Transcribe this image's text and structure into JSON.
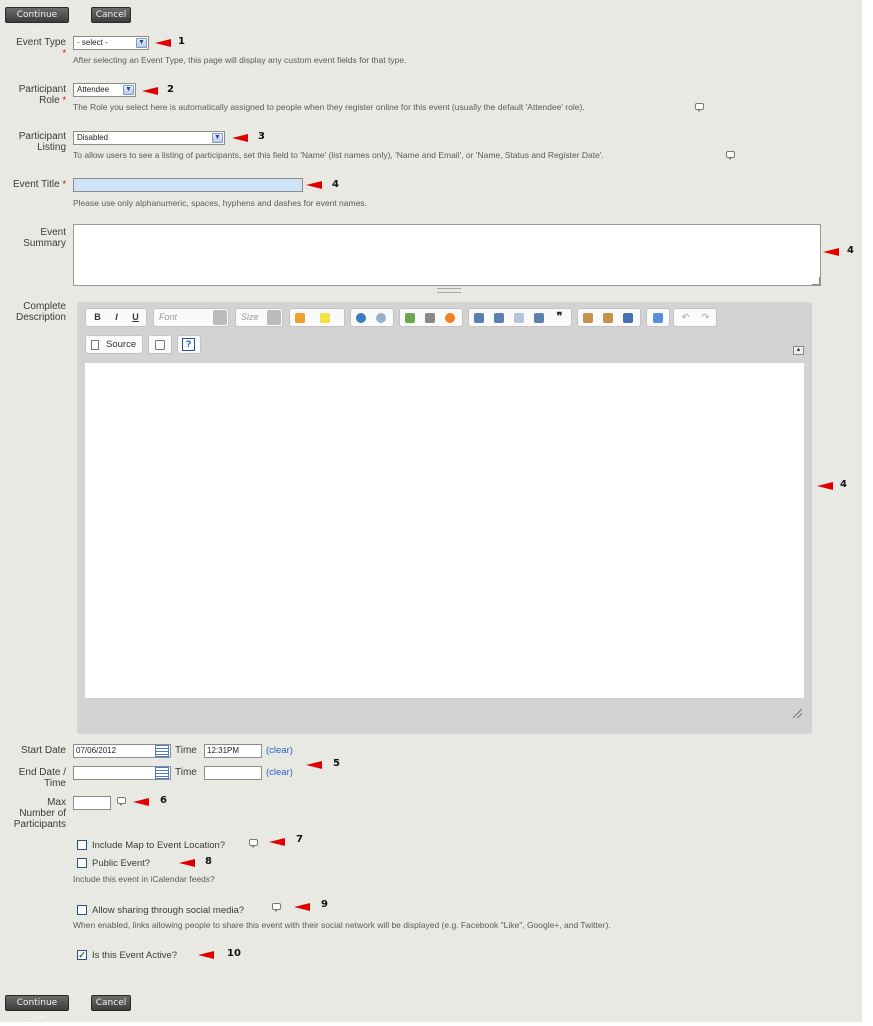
{
  "buttons": {
    "continue": "Continue >>",
    "cancel": "Cancel"
  },
  "fields": {
    "event_type": {
      "label": "Event Type",
      "required": "*",
      "selected": "- select -",
      "marker": "1",
      "help": "After selecting an Event Type, this page will display any custom event fields for that type."
    },
    "participant_role": {
      "label_line1": "Participant",
      "label_line2": "Role",
      "required": "*",
      "selected": "Attendee",
      "marker": "2",
      "help": "The Role you select here is automatically assigned to people when they register online for this event (usually the default 'Attendee' role)."
    },
    "participant_listing": {
      "label_line1": "Participant",
      "label_line2": "Listing",
      "selected": "Disabled",
      "marker": "3",
      "help": "To allow users to see a listing of participants, set this field to 'Name' (list names only), 'Name and Email', or 'Name, Status and Register Date'."
    },
    "event_title": {
      "label": "Event Title",
      "required": "*",
      "value": "",
      "marker": "4",
      "help": "Please use only alphanumeric, spaces, hyphens and dashes for event names."
    },
    "event_summary": {
      "label_line1": "Event",
      "label_line2": "Summary",
      "value": "",
      "marker": "4"
    },
    "complete_description": {
      "label_line1": "Complete",
      "label_line2": "Description",
      "marker": "4"
    }
  },
  "editor": {
    "bold": "B",
    "italic": "I",
    "underline": "U",
    "font_placeholder": "Font",
    "size_placeholder": "Size",
    "source_label": "Source"
  },
  "dates": {
    "start_label": "Start Date",
    "start_date": "07/06/2012",
    "time_label": "Time",
    "start_time": "12:31PM",
    "clear": "(clear)",
    "end_label_line1": "End Date /",
    "end_label_line2": "Time",
    "end_date": "",
    "end_time": "",
    "marker": "5"
  },
  "max_participants": {
    "label_line1": "Max",
    "label_line2": "Number of",
    "label_line3": "Participants",
    "value": "",
    "marker": "6"
  },
  "options": {
    "include_map": {
      "label": "Include Map to Event Location?",
      "checked": false,
      "marker": "7"
    },
    "public_event": {
      "label": "Public Event?",
      "checked": false,
      "marker": "8",
      "help": "Include this event in iCalendar feeds?"
    },
    "social": {
      "label": "Allow sharing through social media?",
      "checked": false,
      "marker": "9",
      "help": "When enabled, links allowing people to share this event with their social network will be displayed (e.g. Facebook \"Like\", Google+, and Twitter)."
    },
    "active": {
      "label": "Is this Event Active?",
      "checked": true,
      "marker": "10"
    }
  },
  "colors": {
    "background": "#e9e9e3",
    "marker_arrow": "#e00000",
    "title_input_bg": "#cfe3f7",
    "link": "#2a62c9"
  }
}
